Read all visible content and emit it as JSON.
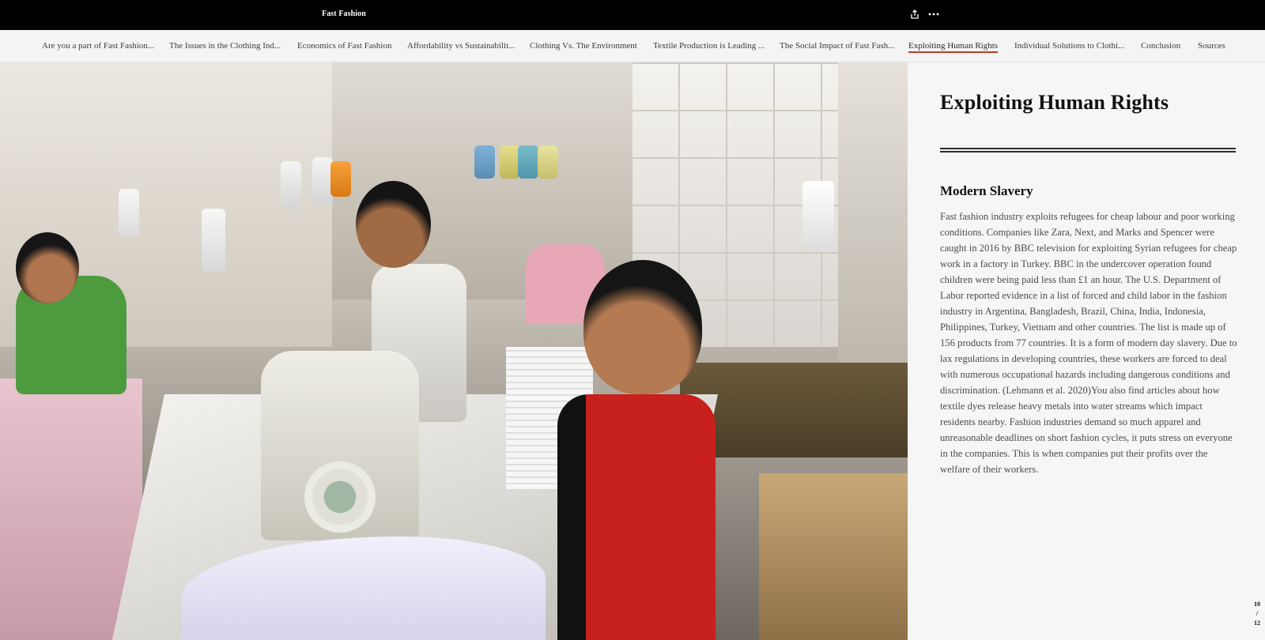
{
  "header": {
    "site_title": "Fast Fashion",
    "share_icon": "share-icon",
    "more_icon": "more-icon"
  },
  "nav": {
    "active_index": 8,
    "items": [
      {
        "label": "Are you a part of Fast Fashion..."
      },
      {
        "label": "The Issues in the Clothing Ind..."
      },
      {
        "label": "Economics of Fast Fashion"
      },
      {
        "label": "Affordability vs Sustainabilit..."
      },
      {
        "label": "Clothing Vs. The Environment"
      },
      {
        "label": "Textile Production is Leading ..."
      },
      {
        "label": "The Social Impact of Fast Fash..."
      },
      {
        "label": "Individual Solutions to Clothi..."
      },
      {
        "label": "Exploiting Human Rights"
      },
      {
        "label": "Conclusion"
      },
      {
        "label": "Sources"
      }
    ]
  },
  "main": {
    "photo_alt": "Young workers at sewing machines in a garment workshop"
  },
  "panel": {
    "heading": "Exploiting Human Rights",
    "subheading": "Modern Slavery",
    "body": "Fast fashion industry exploits refugees for cheap labour and poor working conditions. Companies like Zara, Next, and Marks and Spencer were caught in 2016 by BBC television for exploiting Syrian refugees for cheap work in a factory in Turkey. BBC in the undercover operation found children were being paid less than £1 an hour. The U.S. Department of Labor reported evidence in a list of forced and child labor in the fashion industry in Argentina, Bangladesh, Brazil, China, India, Indonesia, Philippines, Turkey, Vietnam and other countries. The list is made up of 156 products from 77 countries. It is a form of modern day slavery. Due to lax regulations in developing countries, these workers are forced to deal with numerous occupational hazards including dangerous conditions and discrimination. (Lehmann et al. 2020)You also find articles about how textile dyes release heavy metals into water streams which impact residents nearby. Fashion industries demand so much apparel and unreasonable deadlines on short fashion cycles, it puts stress on everyone in the companies. This is when companies put their profits over the welfare of their workers."
  },
  "pager": {
    "current": "10",
    "separator": "/",
    "total": "12"
  },
  "colors": {
    "header_bg": "#000000",
    "nav_bg": "#f4f4f4",
    "active_underline": "#c0392b",
    "panel_bg": "#f6f6f6"
  }
}
